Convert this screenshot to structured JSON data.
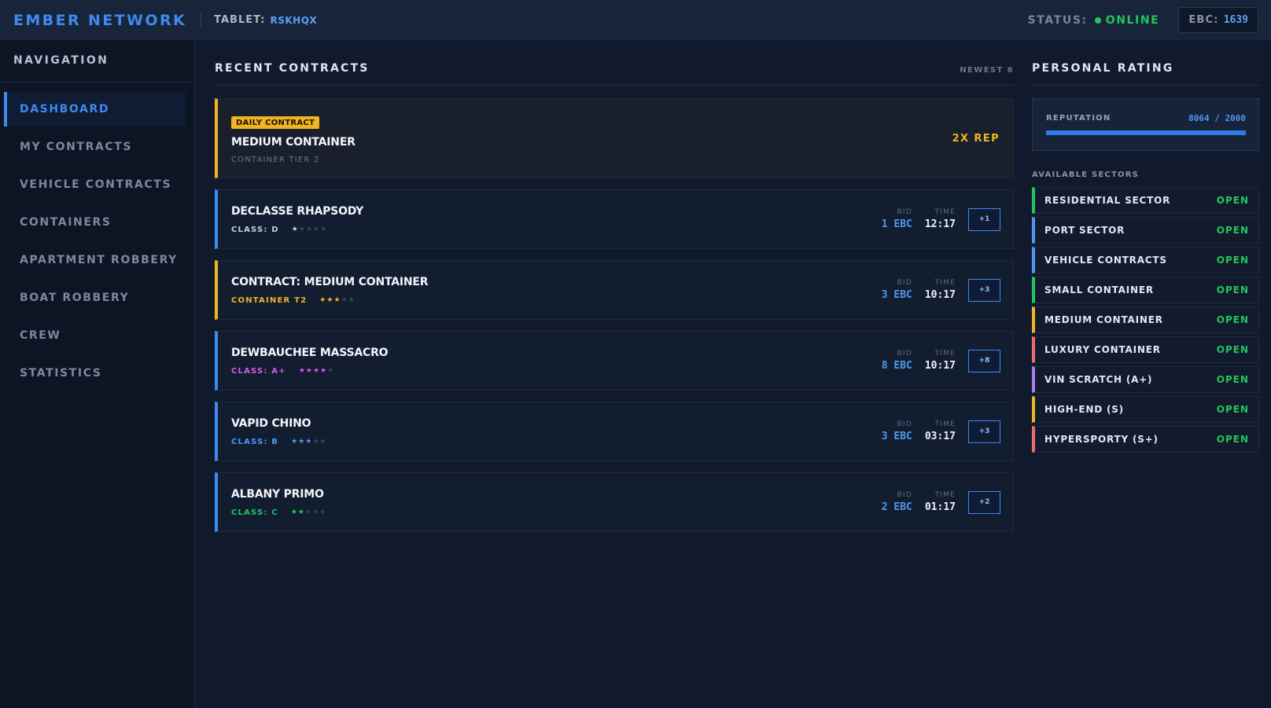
{
  "header": {
    "brand": "EMBER NETWORK",
    "tablet_label": "TABLET:",
    "tablet_id": "RSKHQX",
    "status_label": "STATUS:",
    "status_value": "ONLINE",
    "ebc_label": "EBC:",
    "ebc_value": "1639"
  },
  "sidebar": {
    "title": "NAVIGATION",
    "items": [
      {
        "label": "DASHBOARD",
        "active": true
      },
      {
        "label": "MY CONTRACTS"
      },
      {
        "label": "VEHICLE CONTRACTS"
      },
      {
        "label": "CONTAINERS"
      },
      {
        "label": "APARTMENT ROBBERY"
      },
      {
        "label": "BOAT ROBBERY"
      },
      {
        "label": "CREW"
      },
      {
        "label": "STATISTICS"
      }
    ]
  },
  "contracts": {
    "title": "RECENT CONTRACTS",
    "note": "NEWEST 6",
    "bid_label": "BID",
    "time_label": "TIME",
    "daily": {
      "badge": "DAILY CONTRACT",
      "name": "MEDIUM CONTAINER",
      "sub": "CONTAINER TIER 2",
      "reward": "2X REP",
      "accent": "#f0b422"
    },
    "rows": [
      {
        "name": "DECLASSE RHAPSODY",
        "class": "CLASS: D",
        "class_color": "#c8d0dc",
        "stars": 1,
        "star_color": "#c8d0dc",
        "accent": "#3d8bf0",
        "bid": "1 EBC",
        "time": "12:17",
        "action": "+1"
      },
      {
        "name": "CONTRACT: MEDIUM CONTAINER",
        "class": "CONTAINER T2",
        "class_color": "#f0b422",
        "stars": 3,
        "star_color": "#f0b422",
        "accent": "#f0b422",
        "bid": "3 EBC",
        "time": "10:17",
        "action": "+3"
      },
      {
        "name": "DEWBAUCHEE MASSACRO",
        "class": "CLASS: A+",
        "class_color": "#d65ae8",
        "stars": 4,
        "star_color": "#d65ae8",
        "accent": "#3d8bf0",
        "bid": "8 EBC",
        "time": "10:17",
        "action": "+8"
      },
      {
        "name": "VAPID CHINO",
        "class": "CLASS: B",
        "class_color": "#4f97f0",
        "stars": 3,
        "star_color": "#4f97f0",
        "accent": "#3d8bf0",
        "bid": "3 EBC",
        "time": "03:17",
        "action": "+3"
      },
      {
        "name": "ALBANY PRIMO",
        "class": "CLASS: C",
        "class_color": "#22c55e",
        "stars": 2,
        "star_color": "#22c55e",
        "accent": "#3d8bf0",
        "bid": "2 EBC",
        "time": "01:17",
        "action": "+2"
      }
    ]
  },
  "rating": {
    "title": "PERSONAL RATING",
    "rep_label": "REPUTATION",
    "rep_value": "8064 / 2000",
    "rep_fill": 1.0,
    "sectors_title": "AVAILABLE SECTORS",
    "sectors": [
      {
        "name": "RESIDENTIAL SECTOR",
        "status": "OPEN",
        "accent": "#22c55e"
      },
      {
        "name": "PORT SECTOR",
        "status": "OPEN",
        "accent": "#4f97f0"
      },
      {
        "name": "VEHICLE CONTRACTS",
        "status": "OPEN",
        "accent": "#4f97f0"
      },
      {
        "name": "SMALL CONTAINER",
        "status": "OPEN",
        "accent": "#22c55e"
      },
      {
        "name": "MEDIUM CONTAINER",
        "status": "OPEN",
        "accent": "#f0b422"
      },
      {
        "name": "LUXURY CONTAINER",
        "status": "OPEN",
        "accent": "#ef6b6b"
      },
      {
        "name": "VIN SCRATCH (A+)",
        "status": "OPEN",
        "accent": "#a77cf0"
      },
      {
        "name": "HIGH-END (S)",
        "status": "OPEN",
        "accent": "#f0b422"
      },
      {
        "name": "HYPERSPORTY (S+)",
        "status": "OPEN",
        "accent": "#ef6b6b"
      }
    ]
  }
}
